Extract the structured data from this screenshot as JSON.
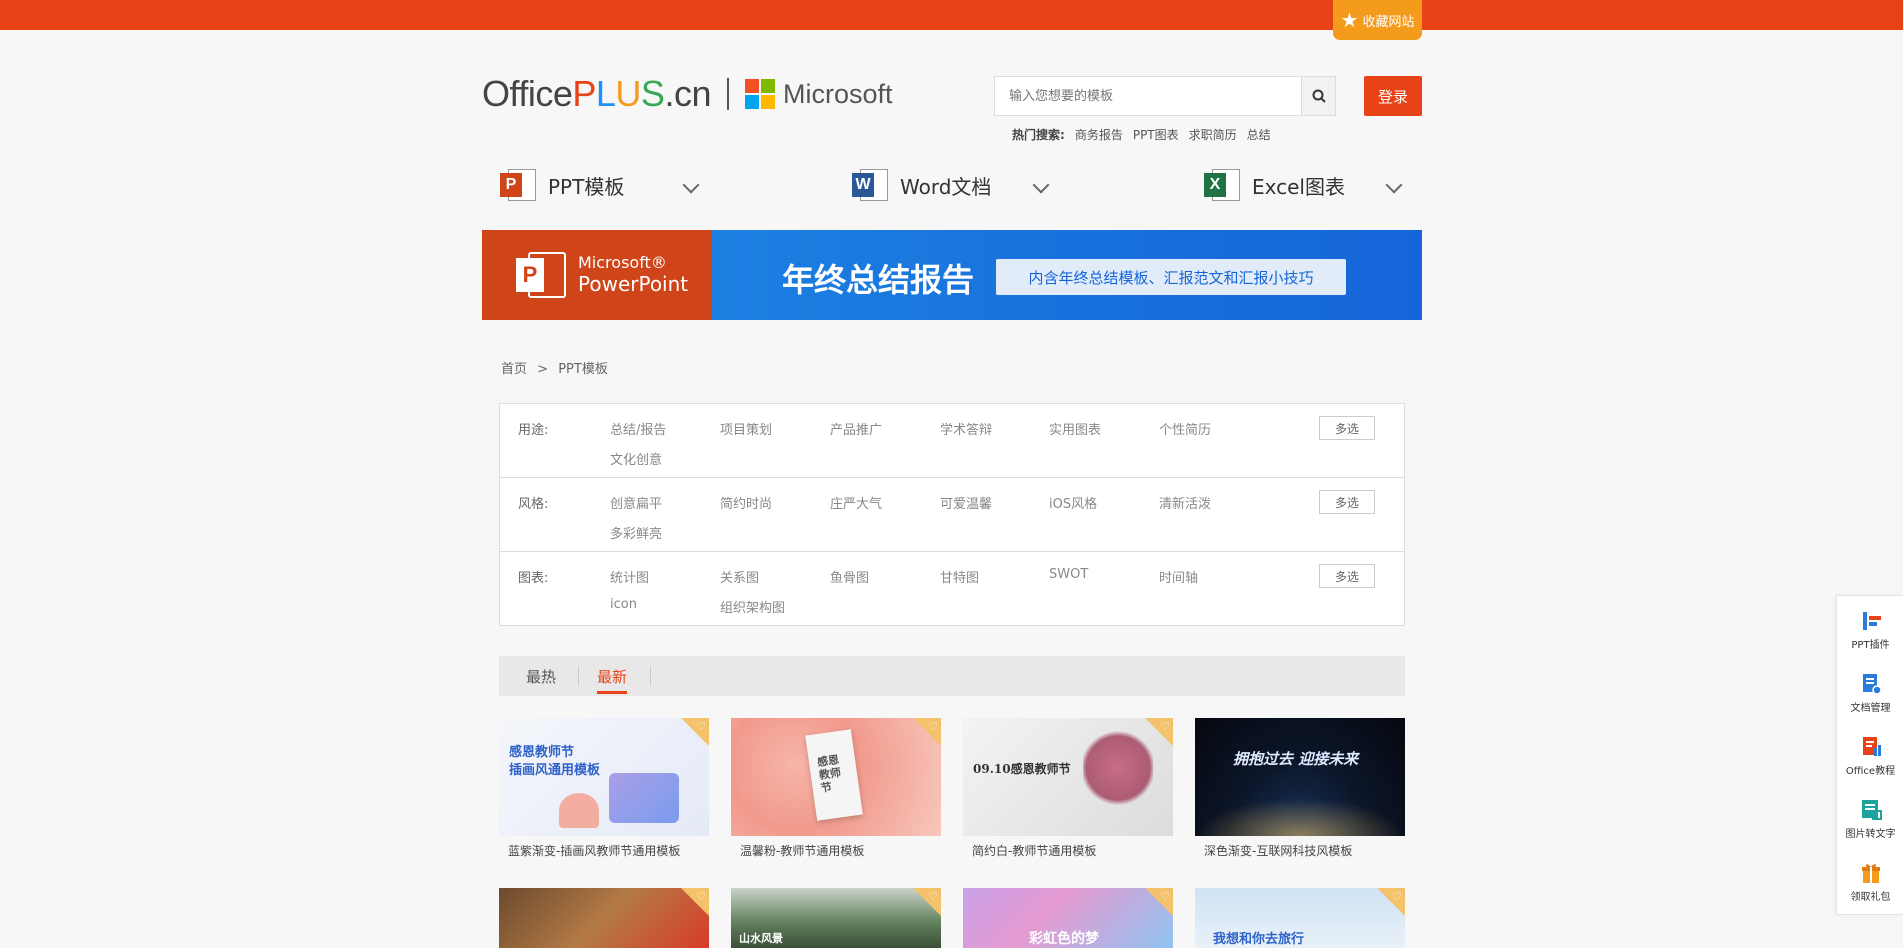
{
  "topbar": {
    "favorite_label": "收藏网站"
  },
  "brand": {
    "office": "Office",
    "plus_p": "P",
    "plus_l": "L",
    "plus_u": "U",
    "plus_s": "S",
    "domain": ".cn",
    "microsoft": "Microsoft"
  },
  "search": {
    "placeholder": "输入您想要的模板",
    "login_label": "登录"
  },
  "hot_search": {
    "label": "热门搜索:",
    "items": [
      "商务报告",
      "PPT图表",
      "求职简历",
      "总结"
    ]
  },
  "nav": [
    {
      "label": "PPT模板",
      "icon": "powerpoint-icon",
      "letter": "P",
      "color": "#d0441a"
    },
    {
      "label": "Word文档",
      "icon": "word-icon",
      "letter": "W",
      "color": "#2b5797"
    },
    {
      "label": "Excel图表",
      "icon": "excel-icon",
      "letter": "X",
      "color": "#217346"
    }
  ],
  "banner": {
    "product_line1": "Microsoft®",
    "product_line2": "PowerPoint",
    "title": "年终总结报告",
    "subtitle": "内含年终总结模板、汇报范文和汇报小技巧"
  },
  "breadcrumb": {
    "home": "首页",
    "sep": ">",
    "current": "PPT模板"
  },
  "filters": [
    {
      "label": "用途:",
      "options": [
        "总结/报告",
        "项目策划",
        "产品推广",
        "学术答辩",
        "实用图表",
        "个性简历",
        "文化创意"
      ],
      "multi": "多选"
    },
    {
      "label": "风格:",
      "options": [
        "创意扁平",
        "简约时尚",
        "庄严大气",
        "可爱温馨",
        "iOS风格",
        "清新活泼",
        "多彩鲜亮"
      ],
      "multi": "多选"
    },
    {
      "label": "图表:",
      "options": [
        "统计图",
        "关系图",
        "鱼骨图",
        "甘特图",
        "SWOT",
        "时间轴",
        "icon",
        "组织架构图"
      ],
      "multi": "多选"
    }
  ],
  "sort_tabs": {
    "hot": "最热",
    "new": "最新"
  },
  "cards": [
    {
      "title": "蓝紫渐变-插画风教师节通用模板",
      "thumb_text": "感恩教师节\n插画风通用模板"
    },
    {
      "title": "温馨粉-教师节通用模板",
      "thumb_text": "感恩教师节"
    },
    {
      "title": "简约白-教师节通用模板",
      "thumb_text": "09.10感恩教师节"
    },
    {
      "title": "深色渐变-互联网科技风模板",
      "thumb_text": "拥抱过去 迎接未来"
    },
    {
      "title": "",
      "thumb_text": ""
    },
    {
      "title": "",
      "thumb_text": "山水风景"
    },
    {
      "title": "",
      "thumb_text": "彩虹色的梦"
    },
    {
      "title": "",
      "thumb_text": "我想和你去旅行"
    }
  ],
  "sidebar": [
    {
      "label": "PPT插件",
      "icon": "ppt-plugin-icon"
    },
    {
      "label": "文档管理",
      "icon": "document-manage-icon"
    },
    {
      "label": "Office教程",
      "icon": "office-tutorial-icon"
    },
    {
      "label": "图片转文字",
      "icon": "image-to-text-icon"
    },
    {
      "label": "领取礼包",
      "icon": "gift-icon"
    }
  ]
}
